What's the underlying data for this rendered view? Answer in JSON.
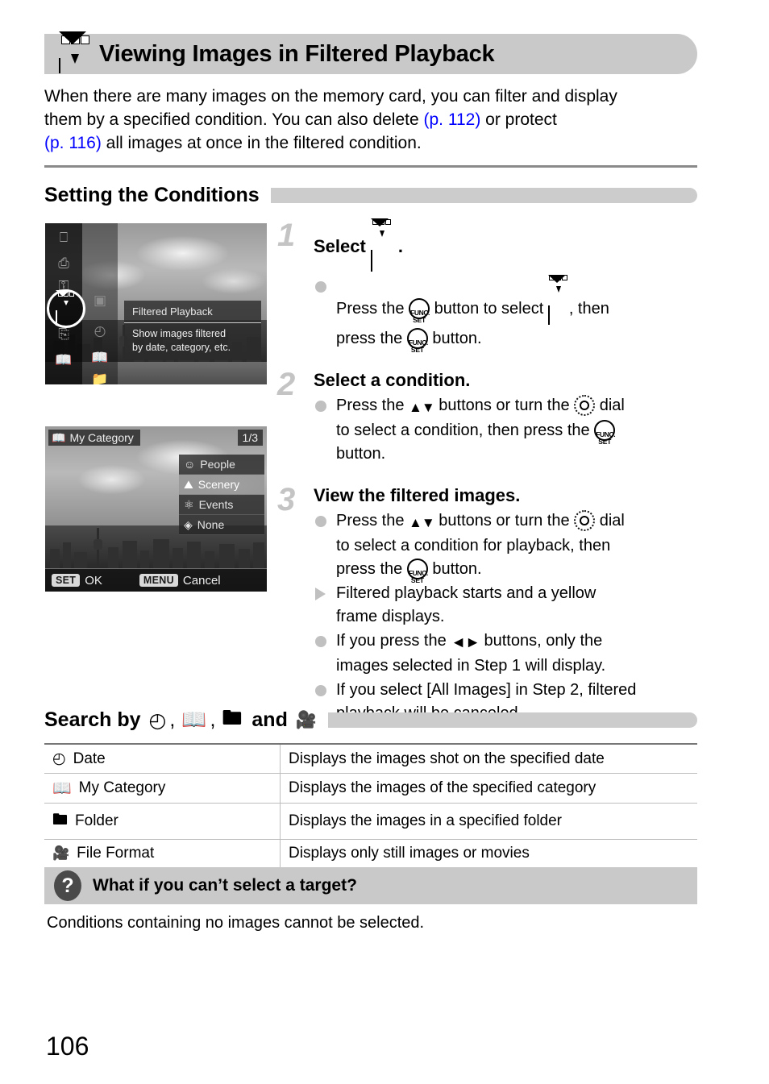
{
  "header": {
    "title": "Viewing Images in Filtered Playback",
    "icon": "filtered-playback-icon"
  },
  "intro": {
    "line1": "When there are many images on the memory card, you can filter and display",
    "line2_a": "them by a specified condition. You can also delete ",
    "ref1": "(p. 112)",
    "line2_b": " or protect",
    "ref2": "(p. 116)",
    "line3_b": " all images at once in the filtered condition."
  },
  "sections": {
    "setting": "Setting the Conditions",
    "search_prefix": "Search by",
    "search_comma": ",",
    "search_and": "and"
  },
  "screen1": {
    "menu_title": "Filtered Playback",
    "menu_desc_line1": "Show images filtered",
    "menu_desc_line2": "by date, category, etc.",
    "sidebar_icons": [
      "rotate-icon",
      "print-icon",
      "protect-key-icon",
      "filtered-playback-icon",
      "transfer-icon",
      "my-category-icon"
    ],
    "sidebar_icons_col2": [
      "images-stack-icon",
      "clock-icon",
      "my-category-icon",
      "folder-icon"
    ]
  },
  "screen2": {
    "title": "My Category",
    "counter": "1/3",
    "options": [
      {
        "label": "People",
        "icon": "people-icon",
        "selected": false
      },
      {
        "label": "Scenery",
        "icon": "scenery-icon",
        "selected": true
      },
      {
        "label": "Events",
        "icon": "events-icon",
        "selected": false
      },
      {
        "label": "None",
        "icon": "none-icon",
        "selected": false
      }
    ],
    "set_key": "SET",
    "set_label": "OK",
    "menu_key": "MENU",
    "menu_label": "Cancel"
  },
  "steps": [
    {
      "num": "1",
      "title_a": "Select",
      "title_b": ".",
      "bullets": [
        {
          "type": "dot",
          "a": "Press the ",
          "b": " button to select ",
          "c": ", then",
          "d": "press the ",
          "e": " button."
        }
      ]
    },
    {
      "num": "2",
      "title_a": "Select a condition.",
      "bullets": [
        {
          "type": "dot",
          "a": "Press the ",
          "b": " buttons or turn the ",
          "c": " dial",
          "d": "to select a condition, then press the ",
          "e": "button."
        }
      ]
    },
    {
      "num": "3",
      "title_a": "View the filtered images.",
      "bullets": [
        {
          "type": "dot",
          "a": "Press the ",
          "b": " buttons or turn the ",
          "c": " dial",
          "d": "to select a condition for playback, then",
          "e": "press the ",
          "f": " button."
        },
        {
          "type": "tri",
          "a": "Filtered playback starts and a yellow",
          "b": "frame displays."
        },
        {
          "type": "dot",
          "a": "If you press the ",
          "b": " buttons, only the",
          "c": "images selected in Step 1 will display."
        },
        {
          "type": "dot",
          "a": "If you select [All Images] in Step 2, filtered",
          "b": "playback will be canceled."
        }
      ]
    }
  ],
  "table": {
    "rows": [
      {
        "icon": "clock-icon",
        "name": "Date",
        "desc": "Displays the images shot on the specified date"
      },
      {
        "icon": "my-category-icon",
        "name": "My Category",
        "desc": "Displays the images of the specified category"
      },
      {
        "icon": "folder-icon",
        "name": "Folder",
        "desc": "Displays the images in a specified folder"
      },
      {
        "icon": "file-format-icon",
        "name": "File Format",
        "desc": "Displays only still images or movies"
      }
    ]
  },
  "tip": {
    "badge": "?",
    "title": "What if you can’t select a target?",
    "body": "Conditions containing no images cannot be selected."
  },
  "page_number": "106",
  "colors": {
    "header_bg": "#c9c9c9",
    "section_bar": "#cccccc",
    "page_ref_link": "#0000ff",
    "bullet_gray": "#c0c0c0",
    "step_number": "#c4c4c4",
    "tip_bg": "#c9c9c9",
    "tip_badge": "#4a4a4a"
  }
}
